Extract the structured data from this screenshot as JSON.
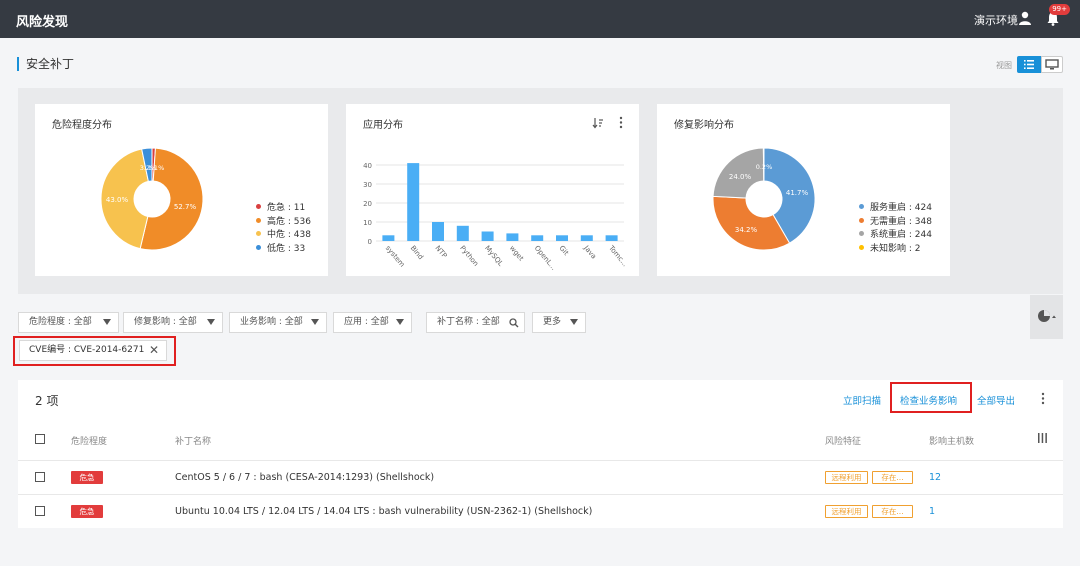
{
  "header": {
    "app_title": "风险发现",
    "env": "演示环境",
    "badge": "99+"
  },
  "page": {
    "title": "安全补丁",
    "view_label": "视图"
  },
  "severity_chart": {
    "title": "危险程度分布",
    "slice_labels": [
      "52.7%",
      "43.0%",
      "3.2%",
      "1.1%"
    ],
    "legend": [
      {
        "label": "危急 : 11",
        "color": "#d94040"
      },
      {
        "label": "高危 : 536",
        "color": "#f08c28"
      },
      {
        "label": "中危 : 438",
        "color": "#f7c24e"
      },
      {
        "label": "低危 : 33",
        "color": "#3b8fd9"
      }
    ]
  },
  "app_chart": {
    "title": "应用分布",
    "ylim": [
      0,
      40
    ],
    "yticks": [
      "40",
      "30",
      "20",
      "10",
      "0"
    ]
  },
  "impact_chart": {
    "title": "修复影响分布",
    "slice_labels": [
      "41.7%",
      "34.2%",
      "24.0%",
      "0.2%"
    ],
    "legend": [
      {
        "label": "服务重启 : 424",
        "color": "#5b9bd5"
      },
      {
        "label": "无需重启 : 348",
        "color": "#ed7d31"
      },
      {
        "label": "系统重启 : 244",
        "color": "#a5a5a5"
      },
      {
        "label": "未知影响 : 2",
        "color": "#ffc000"
      }
    ]
  },
  "chart_data": [
    {
      "type": "pie",
      "title": "危险程度分布",
      "categories": [
        "危急",
        "高危",
        "中危",
        "低危"
      ],
      "values": [
        11,
        536,
        438,
        33
      ],
      "colors": [
        "#d94040",
        "#f08c28",
        "#f7c24e",
        "#3b8fd9"
      ],
      "legend_position": "right"
    },
    {
      "type": "bar",
      "title": "应用分布",
      "categories": [
        "system",
        "Bind",
        "NTP",
        "Python",
        "MySQL",
        "wget",
        "OpenL...",
        "Git",
        "Java",
        "Tomc..."
      ],
      "values": [
        3,
        41,
        10,
        8,
        5,
        4,
        3,
        3,
        3,
        3
      ],
      "ylim": [
        0,
        40
      ],
      "grid": true,
      "color": "#4aaef5"
    },
    {
      "type": "pie",
      "title": "修复影响分布",
      "categories": [
        "服务重启",
        "无需重启",
        "系统重启",
        "未知影响"
      ],
      "values": [
        424,
        348,
        244,
        2
      ],
      "colors": [
        "#5b9bd5",
        "#ed7d31",
        "#a5a5a5",
        "#ffc000"
      ],
      "legend_position": "right"
    }
  ],
  "filters": {
    "severity": "危险程度 : 全部",
    "impact": "修复影响 : 全部",
    "business": "业务影响 : 全部",
    "app": "应用 : 全部",
    "patch_name": "补丁名称 : 全部",
    "more": "更多",
    "cve_tag": "CVE编号 : CVE-2014-6271"
  },
  "table": {
    "count": "2 项",
    "actions": {
      "scan": "立即扫描",
      "check": "检查业务影响",
      "export": "全部导出"
    },
    "headers": {
      "severity": "危险程度",
      "name": "补丁名称",
      "risk": "风险特征",
      "hosts": "影响主机数"
    },
    "rows": [
      {
        "severity": "危急",
        "name": "CentOS 5 / 6 / 7 : bash (CESA-2014:1293) (Shellshock)",
        "risk1": "远程利用",
        "risk2": "存在...",
        "hosts": "12"
      },
      {
        "severity": "危急",
        "name": "Ubuntu 10.04 LTS / 12.04 LTS / 14.04 LTS : bash vulnerability (USN-2362-1) (Shellshock)",
        "risk1": "远程利用",
        "risk2": "存在...",
        "hosts": "1"
      }
    ]
  }
}
